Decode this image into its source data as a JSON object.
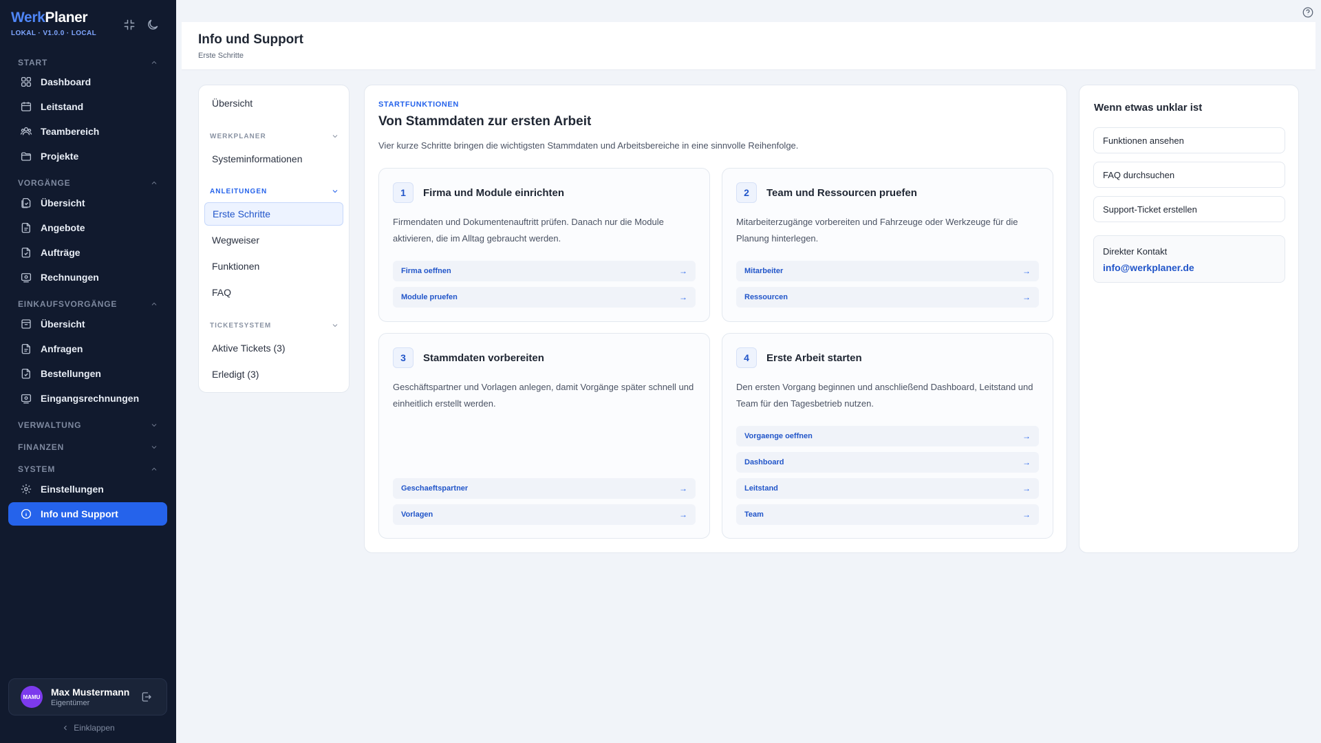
{
  "sidebar": {
    "brand_part1": "Werk",
    "brand_part2": "Planer",
    "version": "LOKAL · V1.0.0 · LOCAL",
    "sections": {
      "start": "START",
      "vorgaenge": "VORGÄNGE",
      "einkauf": "EINKAUFSVORGÄNGE",
      "verwaltung": "VERWALTUNG",
      "finanzen": "FINANZEN",
      "system": "SYSTEM"
    },
    "items": {
      "dashboard": "Dashboard",
      "leitstand": "Leitstand",
      "teambereich": "Teambereich",
      "projekte": "Projekte",
      "vorgaenge_uebersicht": "Übersicht",
      "angebote": "Angebote",
      "auftraege": "Aufträge",
      "rechnungen": "Rechnungen",
      "einkauf_uebersicht": "Übersicht",
      "anfragen": "Anfragen",
      "bestellungen": "Bestellungen",
      "eingangsrechnungen": "Eingangsrechnungen",
      "einstellungen": "Einstellungen",
      "info_support": "Info und Support"
    },
    "user": {
      "initials": "MAMU",
      "name": "Max Mustermann",
      "role": "Eigentümer"
    },
    "collapse_label": "Einklappen"
  },
  "header": {
    "title": "Info und Support",
    "breadcrumb": "Erste Schritte"
  },
  "subnav": {
    "overview": "Übersicht",
    "section_werkplaner": "WERKPLANER",
    "systeminfo": "Systeminformationen",
    "section_anleitungen": "ANLEITUNGEN",
    "erste_schritte": "Erste Schritte",
    "wegweiser": "Wegweiser",
    "funktionen": "Funktionen",
    "faq": "FAQ",
    "section_ticketsystem": "TICKETSYSTEM",
    "aktive_tickets": "Aktive Tickets (3)",
    "erledigt": "Erledigt (3)"
  },
  "main": {
    "overline": "STARTFUNKTIONEN",
    "title": "Von Stammdaten zur ersten Arbeit",
    "description": "Vier kurze Schritte bringen die wichtigsten Stammdaten und Arbeitsbereiche in eine sinnvolle Reihenfolge.",
    "steps": [
      {
        "num": "1",
        "title": "Firma und Module einrichten",
        "desc": "Firmendaten und Dokumentenauftritt prüfen. Danach nur die Module aktivieren, die im Alltag gebraucht werden.",
        "links": [
          "Firma oeffnen",
          "Module pruefen"
        ]
      },
      {
        "num": "2",
        "title": "Team und Ressourcen pruefen",
        "desc": "Mitarbeiterzugänge vorbereiten und Fahrzeuge oder Werkzeuge für die Planung hinterlegen.",
        "links": [
          "Mitarbeiter",
          "Ressourcen"
        ]
      },
      {
        "num": "3",
        "title": "Stammdaten vorbereiten",
        "desc": "Geschäftspartner und Vorlagen anlegen, damit Vorgänge später schnell und einheitlich erstellt werden.",
        "links": [
          "Geschaeftspartner",
          "Vorlagen"
        ]
      },
      {
        "num": "4",
        "title": "Erste Arbeit starten",
        "desc": "Den ersten Vorgang beginnen und anschließend Dashboard, Leitstand und Team für den Tagesbetrieb nutzen.",
        "links": [
          "Vorgaenge oeffnen",
          "Dashboard",
          "Leitstand",
          "Team"
        ]
      }
    ],
    "arrow": "→"
  },
  "help": {
    "title": "Wenn etwas unklar ist",
    "buttons": [
      "Funktionen ansehen",
      "FAQ durchsuchen",
      "Support-Ticket erstellen"
    ],
    "contact_label": "Direkter Kontakt",
    "contact_email": "info@werkplaner.de"
  },
  "colors": {
    "sidebar_bg": "#111a2e",
    "accent": "#2563eb",
    "avatar": "#7c3aed"
  }
}
